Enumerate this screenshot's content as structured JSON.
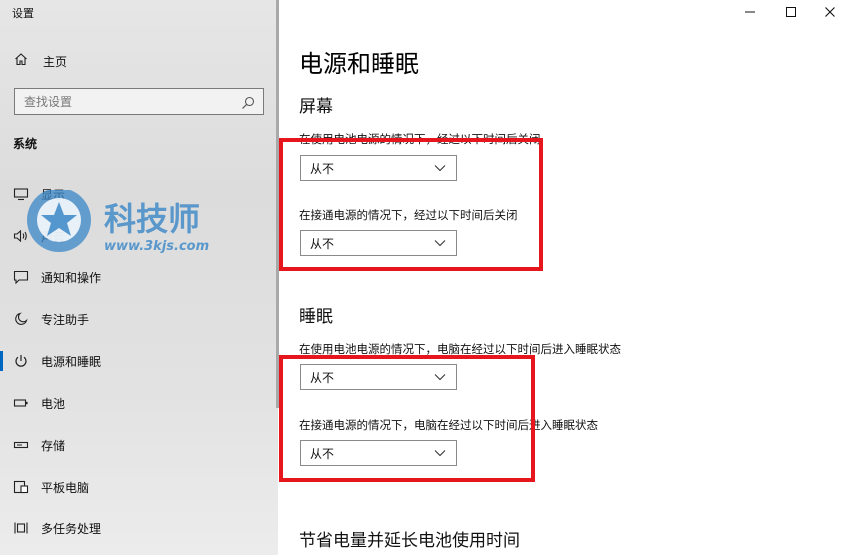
{
  "window": {
    "title": "设置"
  },
  "sidebar": {
    "home_label": "主页",
    "search_placeholder": "查找设置",
    "section_label": "系统",
    "items": [
      {
        "label": "显示",
        "icon": "monitor-icon"
      },
      {
        "label": "声音",
        "icon": "speaker-icon"
      },
      {
        "label": "通知和操作",
        "icon": "notification-icon"
      },
      {
        "label": "专注助手",
        "icon": "moon-icon"
      },
      {
        "label": "电源和睡眠",
        "icon": "power-icon",
        "active": true
      },
      {
        "label": "电池",
        "icon": "battery-icon"
      },
      {
        "label": "存储",
        "icon": "storage-icon"
      },
      {
        "label": "平板电脑",
        "icon": "tablet-icon"
      },
      {
        "label": "多任务处理",
        "icon": "multitask-icon"
      }
    ]
  },
  "watermark": {
    "title": "科技师",
    "url": "www.3kjs.com"
  },
  "main": {
    "title": "电源和睡眠",
    "screen": {
      "heading": "屏幕",
      "battery_label": "在使用电池电源的情况下，经过以下时间后关闭",
      "battery_value": "从不",
      "plugged_label": "在接通电源的情况下，经过以下时间后关闭",
      "plugged_value": "从不"
    },
    "sleep": {
      "heading": "睡眠",
      "battery_label": "在使用电池电源的情况下，电脑在经过以下时间后进入睡眠状态",
      "battery_value": "从不",
      "plugged_label": "在接通电源的情况下，电脑在经过以下时间后进入睡眠状态",
      "plugged_value": "从不"
    },
    "battery_saver_heading": "节省电量并延长电池使用时间"
  },
  "colors": {
    "accent": "#0067c0",
    "highlight": "#e5161c",
    "watermark": "#3a87c8"
  }
}
